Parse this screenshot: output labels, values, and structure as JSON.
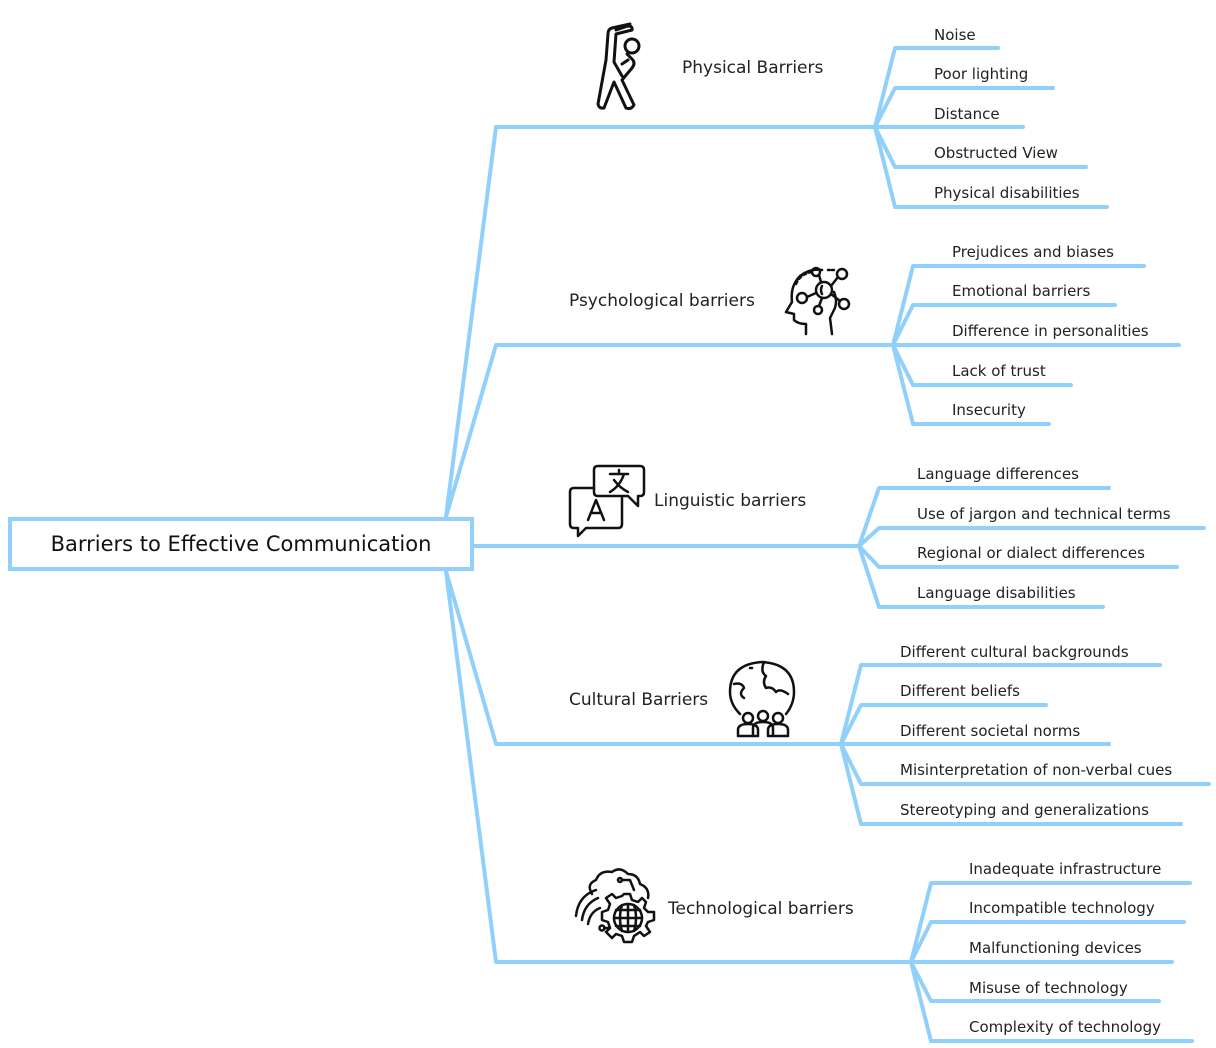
{
  "root": {
    "label": "Barriers to Effective Communication"
  },
  "theme": {
    "line_color": "#90d0fb",
    "text_color": "#222222",
    "icon_color": "#111111"
  },
  "branches": [
    {
      "label": "Physical Barriers",
      "icon": "stretching-person-icon",
      "items": [
        "Noise",
        "Poor lighting",
        "Distance",
        "Obstructed View",
        "Physical disabilities"
      ]
    },
    {
      "label": "Psychological barriers",
      "icon": "head-network-icon",
      "items": [
        "Prejudices and biases",
        "Emotional barriers",
        "Difference in personalities",
        "Lack of trust",
        "Insecurity"
      ]
    },
    {
      "label": "Linguistic barriers",
      "icon": "translation-bubbles-icon",
      "items": [
        "Language differences",
        "Use of jargon and technical terms",
        "Regional or dialect differences",
        "Language disabilities"
      ]
    },
    {
      "label": "Cultural Barriers",
      "icon": "globe-people-icon",
      "items": [
        "Different cultural backgrounds",
        "Different beliefs",
        "Different societal norms",
        "Misinterpretation of non-verbal cues",
        "Stereotyping and generalizations"
      ]
    },
    {
      "label": "Technological barriers",
      "icon": "cloud-gear-globe-icon",
      "items": [
        "Inadequate infrastructure",
        "Incompatible technology",
        "Malfunctioning devices",
        "Misuse of technology",
        "Complexity of technology"
      ]
    }
  ]
}
